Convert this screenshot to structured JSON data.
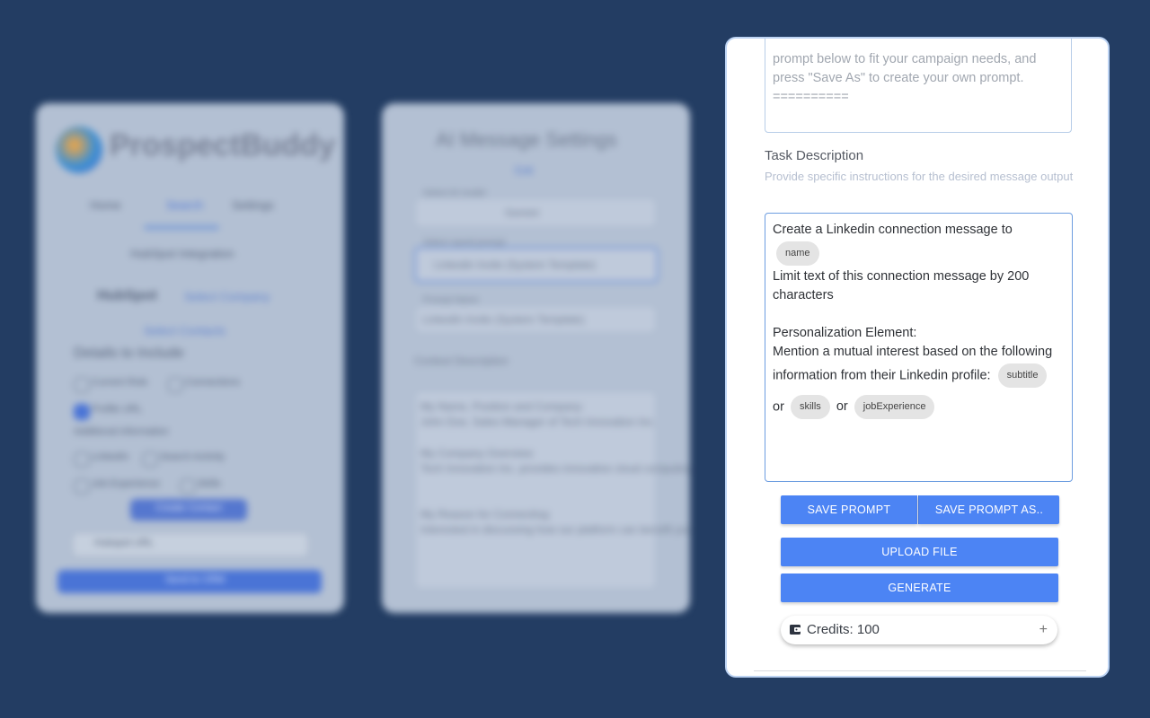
{
  "background": {
    "left_panel": {
      "brand": "ProspectBuddy",
      "tabs": [
        "Home",
        "Search",
        "Settings"
      ],
      "integration_title": "HubSpot Integration",
      "hubspot_logo": "HubSpot",
      "hubspot_link": "Select Company",
      "hubspot_sub_link": "Select Contacts",
      "details_heading": "Details to Include",
      "options": [
        "Current Role",
        "Connections",
        "Profile URL",
        "Additional information",
        "LinkedIn",
        "Search Activity",
        "Job Experience",
        "Skills"
      ],
      "button": "Create Contact",
      "select_label": "Hubspot URL",
      "bottom_button": "Send to CRM"
    },
    "mid_panel": {
      "title": "AI Message Settings",
      "mode": "Edit",
      "field1_label": "Select AI model",
      "field1_value": "Gemini",
      "field2_label": "Select saved prompt",
      "field2_value": "Linkedin Invite (System Template)",
      "field3_label": "Prompt Name",
      "field3_value": "LinkedIn Invite (System Template)",
      "context_label": "Context Description",
      "context_lines": [
        "My Name, Position and Company:",
        "John Doe, Sales Manager of Tech Innovation Inc.",
        "My Company Overview:",
        "Tech Innovation Inc. provides innovative cloud computing solutions.",
        "My Reason for Connecting:",
        "Interested in discussing how our platform can benefit you."
      ]
    }
  },
  "card": {
    "prompt_text": "prompt below to fit your campaign needs, and\npress \"Save As\" to create your own prompt.\n==========",
    "task_title": "Task Description",
    "task_subtitle": "Provide specific instructions for the desired message output",
    "editor": {
      "line1": "Create a Linkedin connection message to",
      "chip_name": "name",
      "line2": "Limit text of this connection message by 200 characters",
      "line3": "Personalization Element:",
      "line4a": "Mention a mutual interest based on the following information from their Linkedin profile:",
      "chip_subtitle": "subtitle",
      "or1": "or",
      "chip_skills": "skills",
      "or2": "or",
      "chip_job": "jobExperience"
    },
    "buttons": {
      "save": "SAVE PROMPT",
      "save_as": "SAVE PROMPT AS..",
      "upload": "UPLOAD FILE",
      "generate": "GENERATE"
    },
    "credits": {
      "label": "Credits: 100",
      "plus": "+"
    }
  },
  "colors": {
    "page_background": "#233d63",
    "accent": "#4c84f4",
    "card_border": "#bcd3f3"
  },
  "icons": [
    "wallet-icon",
    "plus-icon"
  ]
}
